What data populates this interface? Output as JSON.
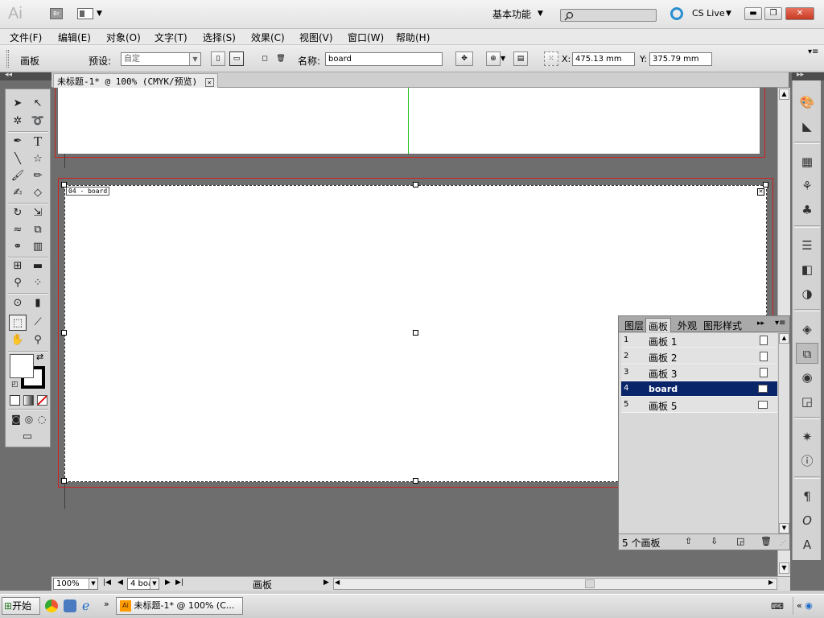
{
  "app": {
    "logo": "Ai",
    "bridge_label": "Br",
    "workspace": "基本功能",
    "cs_live": "CS Live"
  },
  "menu": [
    "文件(F)",
    "编辑(E)",
    "对象(O)",
    "文字(T)",
    "选择(S)",
    "效果(C)",
    "视图(V)",
    "窗口(W)",
    "帮助(H)"
  ],
  "control": {
    "mode_label": "画板",
    "preset_label": "预设:",
    "preset_value": "自定",
    "name_label": "名称:",
    "name_value": "board",
    "x_label": "X:",
    "x_value": "475.13 mm",
    "y_label": "Y:",
    "y_value": "375.79 mm"
  },
  "document": {
    "tab_title": "未标题-1* @ 100% (CMYK/预览)"
  },
  "canvas": {
    "artboard_label": "04 - board"
  },
  "panel": {
    "tabs": [
      "图层",
      "画板",
      "外观",
      "图形样式"
    ],
    "active_tab": "画板",
    "rows": [
      {
        "num": "1",
        "name": "画板 1"
      },
      {
        "num": "2",
        "name": "画板 2"
      },
      {
        "num": "3",
        "name": "画板 3"
      },
      {
        "num": "4",
        "name": "board"
      },
      {
        "num": "5",
        "name": "画板 5"
      }
    ],
    "selected_index": 3,
    "footer": "5 个画板"
  },
  "bottom": {
    "zoom": "100%",
    "artboard_nav": "4 boa",
    "status": "画板"
  },
  "taskbar": {
    "start": "开始",
    "task": "未标题-1* @ 100% (C..."
  },
  "colors": {
    "selection": "#0a246a",
    "artboard_border": "#d02020",
    "guide": "#1bc41b"
  }
}
